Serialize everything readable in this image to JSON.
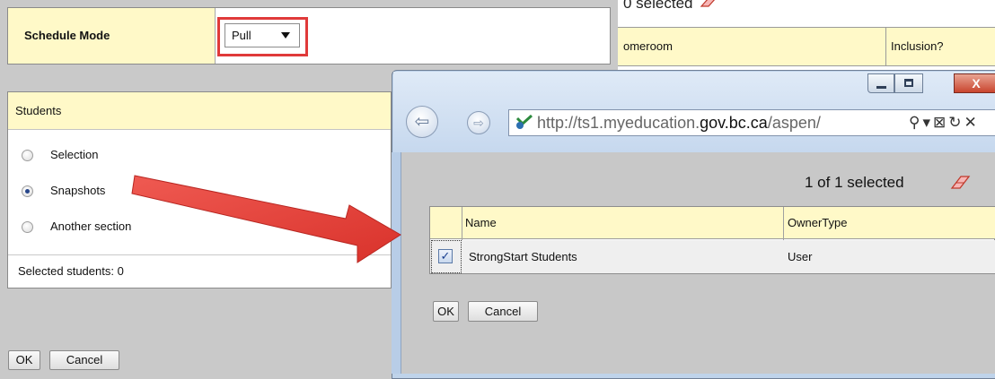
{
  "schedule": {
    "label": "Schedule Mode",
    "selected_value": "Pull"
  },
  "background_grid": {
    "selected_text": "0 selected",
    "columns": [
      "omeroom",
      "Inclusion?"
    ]
  },
  "students": {
    "title": "Students",
    "options": [
      {
        "label": "Selection",
        "checked": false
      },
      {
        "label": "Snapshots",
        "checked": true
      },
      {
        "label": "Another section",
        "checked": false
      }
    ],
    "selected_count_text": "Selected students:  0"
  },
  "main_buttons": {
    "ok": "OK",
    "cancel": "Cancel"
  },
  "popup": {
    "caption_close": "X",
    "address": {
      "prefix": "http://ts1.myeducation.",
      "domain": "gov.bc.ca",
      "suffix": "/aspen/"
    },
    "selected_text": "1 of 1 selected",
    "columns": [
      "Name",
      "OwnerType"
    ],
    "rows": [
      {
        "name": "StrongStart Students",
        "owner_type": "User",
        "checked": true
      }
    ],
    "buttons": {
      "ok": "OK",
      "cancel": "Cancel"
    }
  },
  "colors": {
    "header_yellow": "#fff9c8",
    "highlight_red": "#e03a3a",
    "arrow_red": "#e2403a"
  },
  "icons": [
    "dropdown-caret-icon",
    "eraser-icon",
    "back-arrow-icon",
    "forward-arrow-icon",
    "site-favicon-icon",
    "search-icon",
    "refresh-icon",
    "close-icon",
    "minimize-icon",
    "maximize-icon",
    "checkbox-checked-icon",
    "pointer-arrow-annotation"
  ]
}
